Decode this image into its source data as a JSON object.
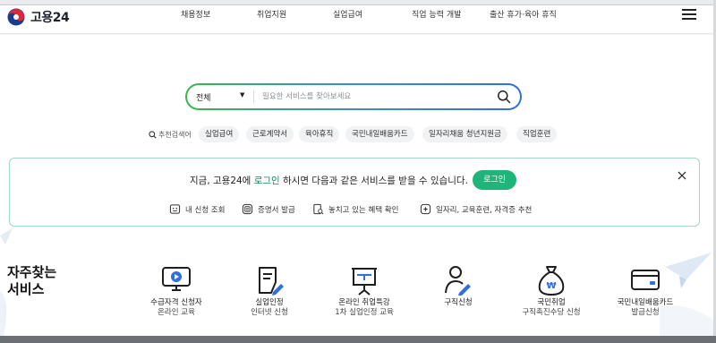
{
  "header": {
    "logo_text": "고용24",
    "nav": [
      "채용정보",
      "취업지원",
      "실업급여",
      "직업 능력 개발",
      "출산 휴가·육아 휴직"
    ]
  },
  "search": {
    "category": "전체",
    "placeholder": "필요한 서비스를 찾아보세요",
    "value": ""
  },
  "recommended": {
    "label": "추천검색어",
    "keywords": [
      "실업급여",
      "근로계약서",
      "육아휴직",
      "국민내일배움카드",
      "일자리채움 청년지원금",
      "직업훈련"
    ]
  },
  "banner": {
    "message_prefix": "지금, 고용24에 ",
    "message_em": "로그인",
    "message_suffix": " 하시면 다음과 같은 서비스를 받을 수 있습니다.",
    "login_button": "로그인",
    "links": [
      "내 신청 조회",
      "증명서 발급",
      "놓치고 있는 혜택 확인",
      "일자리, 교육훈련, 자격증 추천"
    ]
  },
  "favorites": {
    "title_line1": "자주찾는",
    "title_line2": "서비스",
    "items": [
      {
        "line1": "수급자격 신청자",
        "line2": "온라인 교육",
        "icon": "video-monitor-icon"
      },
      {
        "line1": "실업인정",
        "line2": "인터넷 신청",
        "icon": "document-pen-icon"
      },
      {
        "line1": "온라인 취업특강",
        "line2": "1차 실업인정 교육",
        "icon": "presentation-board-icon"
      },
      {
        "line1": "구직신청",
        "line2": "",
        "icon": "person-pen-icon"
      },
      {
        "line1": "국민취업",
        "line2": "구직촉진수당 신청",
        "icon": "money-bag-icon"
      },
      {
        "line1": "국민내일배움카드",
        "line2": "발급신청",
        "icon": "card-icon"
      }
    ]
  },
  "colors": {
    "accent_green": "#1fb57a",
    "banner_border": "#9fd8c4",
    "icon_blue": "#2f6fe0"
  }
}
